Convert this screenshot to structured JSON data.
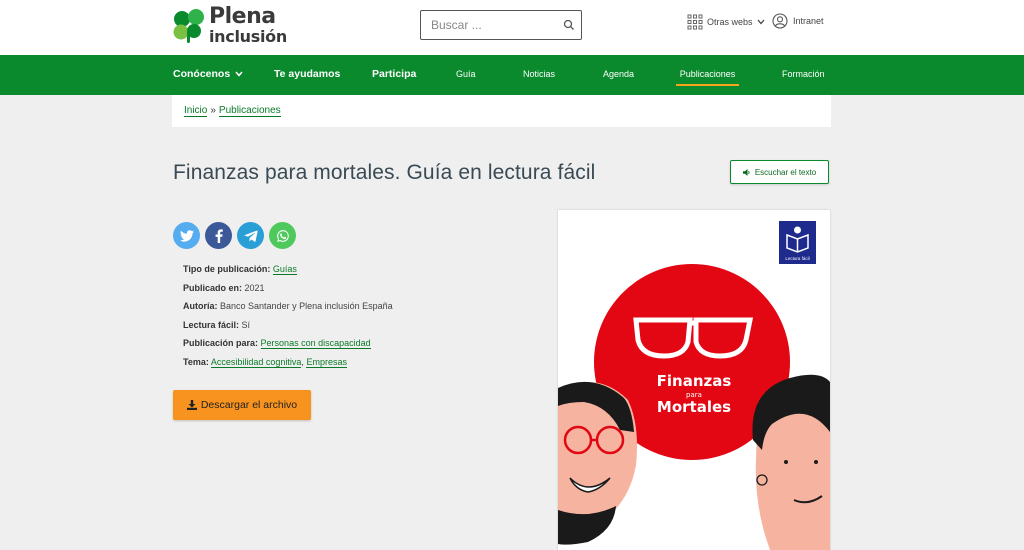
{
  "brand": {
    "line1": "Plena",
    "line2": "inclusión"
  },
  "search": {
    "placeholder": "Buscar ..."
  },
  "header": {
    "otras_webs": "Otras webs",
    "intranet": "Intranet"
  },
  "nav": {
    "items": [
      {
        "label": "Conócenos"
      },
      {
        "label": "Te ayudamos"
      },
      {
        "label": "Participa"
      },
      {
        "label": "Guía"
      },
      {
        "label": "Noticias"
      },
      {
        "label": "Agenda"
      },
      {
        "label": "Publicaciones"
      },
      {
        "label": "Formación"
      }
    ],
    "active": "Publicaciones"
  },
  "breadcrumb": {
    "home": "Inicio",
    "separator": "»",
    "current": "Publicaciones"
  },
  "page": {
    "title": "Finanzas para mortales. Guía en lectura fácil",
    "listen_label": "Escuchar el texto"
  },
  "meta": {
    "tipo_label": "Tipo de publicación:",
    "tipo_value": "Guías",
    "publicado_label": "Publicado en:",
    "publicado_value": "2021",
    "autoria_label": "Autoría:",
    "autoria_value": "Banco Santander y Plena inclusión España",
    "lectura_label": "Lectura fácil:",
    "lectura_value": "Sí",
    "para_label": "Publicación para:",
    "para_value": "Personas con discapacidad",
    "tema_label": "Tema:",
    "tema_value1": "Accesibilidad cognitiva",
    "tema_sep": ",",
    "tema_value2": "Empresas"
  },
  "download_label": "Descargar el archivo",
  "cover": {
    "line1": "Finanzas",
    "line2": "para",
    "line3": "Mortales",
    "badge": "Lectura fácil"
  },
  "colors": {
    "green": "#0a8a2c",
    "orange": "#f7931e",
    "red": "#e30613",
    "navy": "#1e2a8c"
  },
  "icons": [
    "clover-logo-icon",
    "search-icon",
    "grid-icon",
    "chevron-down-icon",
    "user-icon",
    "speaker-icon",
    "twitter-icon",
    "facebook-icon",
    "telegram-icon",
    "whatsapp-icon",
    "download-icon"
  ]
}
